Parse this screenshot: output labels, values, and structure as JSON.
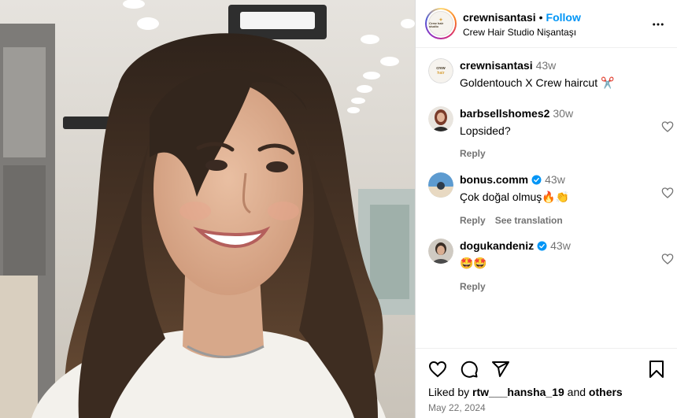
{
  "post": {
    "image_alt": "",
    "header": {
      "username": "crewnisantasi",
      "separator": "•",
      "follow_label": "Follow",
      "location": "Crew Hair Studio Nişantaşı",
      "avatar_text": "Crew hair studio",
      "more_icon": "more-horizontal-icon"
    },
    "caption": {
      "username": "crewnisantasi",
      "time": "43w",
      "text": "Goldentouch X Crew haircut ✂️"
    },
    "comments": [
      {
        "username": "barbsellshomes2",
        "verified": false,
        "time": "30w",
        "text": "Lopsided?",
        "actions": [
          "Reply"
        ]
      },
      {
        "username": "bonus.comm",
        "verified": true,
        "time": "43w",
        "text": "Çok doğal olmuş🔥👏",
        "actions": [
          "Reply",
          "See translation"
        ]
      },
      {
        "username": "dogukandeniz",
        "verified": true,
        "time": "43w",
        "text": "🤩🤩",
        "actions": [
          "Reply"
        ]
      }
    ],
    "footer": {
      "icons": [
        "heart-icon",
        "comment-icon",
        "share-icon",
        "bookmark-icon"
      ],
      "liked_by_prefix": "Liked by",
      "liked_by_user": "rtw___hansha_19",
      "liked_by_and": "and",
      "liked_by_others": "others",
      "date": "May 22, 2024"
    },
    "colors": {
      "follow": "#0095f6",
      "verified": "#0095f6",
      "muted": "#737373"
    }
  }
}
